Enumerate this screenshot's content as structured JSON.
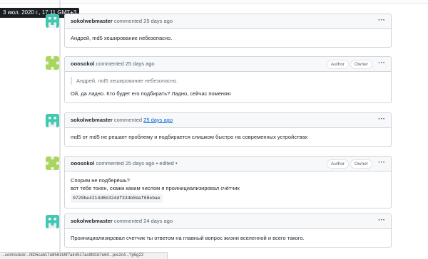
{
  "tooltip": "3 июл. 2020 г., 17:11 GMT+3",
  "status_url": "...com/sokol/.../8D5cab17e8561b5f7a44517ac8fd1b7e60...pre2c4...?p5g22",
  "comments": [
    {
      "author": "sokolwebmaster",
      "time_prefix": "commented",
      "time": "25 days ago",
      "body": "Андрей, md5 хеширование небезопасно."
    },
    {
      "author": "ooosokol",
      "time_prefix": "commented",
      "time": "25 days ago",
      "badge_author": "Author",
      "badge_owner": "Owner",
      "quote": "Андрей, md5 хеширование небезопасно.",
      "body": "Ой, да ладно. Кто будет его подбирать? Ладно, сейчас поменяю"
    },
    {
      "author": "sokolwebmaster",
      "time_prefix": "commented",
      "time": "25 days ago",
      "body": "md5 от md5 не решает проблему и подбирается слишком быстро на современных устройствах"
    },
    {
      "author": "ooosokol",
      "time_prefix": "commented",
      "time": "25 days ago",
      "edited": "• edited",
      "badge_author": "Author",
      "badge_owner": "Owner",
      "body_line1": "Спорим не подберёшь?",
      "body_line2": "вот тебе токен, скажи каким числом я проинициализировал счётчик",
      "code": "0720be4214d6b324df334b8daf68ebae"
    },
    {
      "author": "sokolwebmaster",
      "time_prefix": "commented",
      "time": "24 days ago",
      "body": "Проинициализировал счетчик ты ответом на главный вопрос жизни вселенной и всего такого."
    }
  ],
  "more_icon": "kebab-horizontal-icon",
  "colors": {
    "accent": "#0366d6",
    "identicon_a": "#3fc8b2",
    "identicon_b": "#a9d65c"
  }
}
